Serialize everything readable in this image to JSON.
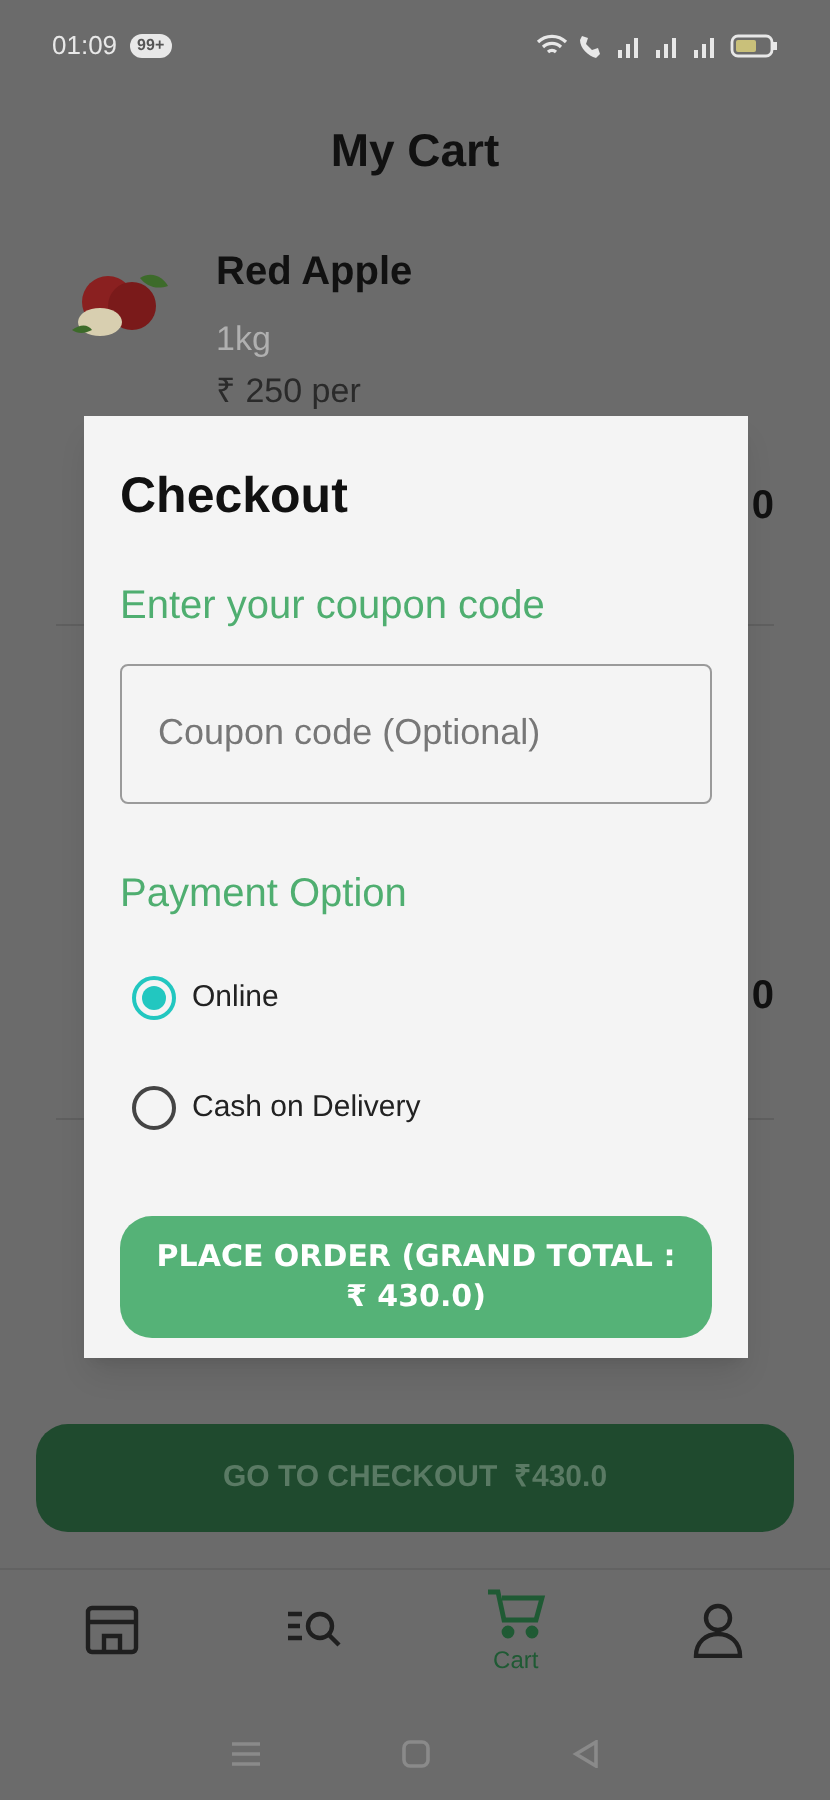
{
  "status_bar": {
    "time": "01:09",
    "notification_badge": "99+"
  },
  "header": {
    "title": "My Cart"
  },
  "cart_items": [
    {
      "name": "Red Apple",
      "weight": "1kg",
      "unit_price": "₹ 250 per",
      "price": "0"
    },
    {
      "price": "0"
    }
  ],
  "checkout_button": {
    "label": "GO TO CHECKOUT  ₹430.0"
  },
  "bottom_nav": [
    {
      "kind": "store",
      "selected": false
    },
    {
      "kind": "search",
      "selected": false
    },
    {
      "kind": "cart",
      "label": "Cart",
      "selected": true
    },
    {
      "kind": "profile",
      "selected": false
    }
  ],
  "dialog": {
    "title": "Checkout",
    "coupon_heading": "Enter your coupon code",
    "coupon_field": {
      "placeholder": "Coupon code (Optional)"
    },
    "payment_heading": "Payment Option",
    "payment_options": [
      {
        "label": "Online",
        "selected": true
      },
      {
        "label": "Cash on Delivery",
        "selected": false
      }
    ],
    "place_order_button": {
      "label": "PLACE ORDER (GRAND TOTAL : ₹ 430.0)"
    }
  }
}
